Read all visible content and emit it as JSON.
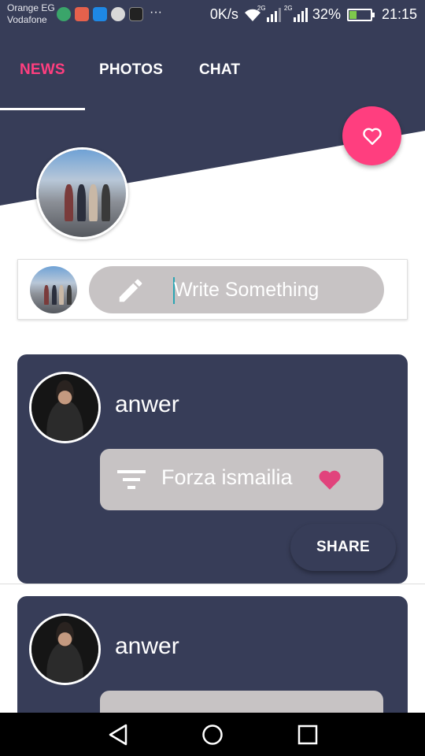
{
  "status_bar": {
    "carrier_1": "Orange EG",
    "carrier_2": "Vodafone",
    "more": "···",
    "net_speed": "0K/s",
    "sim1_type": "2G",
    "sim2_type": "2G",
    "battery": "32%",
    "time": "21:15",
    "battery_level": 0.32
  },
  "tabs": [
    {
      "label": "NEWS",
      "active": true
    },
    {
      "label": "PHOTOS",
      "active": false
    },
    {
      "label": "CHAT",
      "active": false
    }
  ],
  "composer": {
    "placeholder": "Write Something"
  },
  "posts": [
    {
      "author": "anwer",
      "text": "Forza ismailia",
      "emoji": "heart",
      "share_label": "SHARE"
    },
    {
      "author": "anwer"
    }
  ],
  "colors": {
    "primary": "#373d58",
    "accent": "#ff3e7f",
    "bubble": "#c7c3c4"
  },
  "icons": {
    "fab": "heart-outline-icon",
    "composer": "pencil-icon",
    "post": "filter-icon",
    "nav": [
      "back-icon",
      "home-icon",
      "recents-icon"
    ]
  }
}
